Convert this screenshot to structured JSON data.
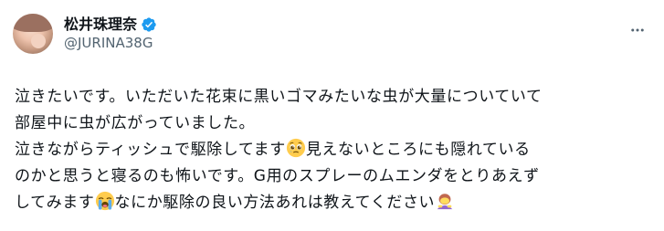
{
  "author": {
    "display_name": "松井珠理奈",
    "handle": "@JURINA38G",
    "avatar": "user-avatar-photo"
  },
  "icons": {
    "verified": "verified-badge-icon",
    "more": "more-options-icon"
  },
  "colors": {
    "verified": "#1d9bf0",
    "text": "#0f1419",
    "muted": "#536471"
  },
  "tweet": {
    "line1": "泣きたいです。いただいた花束に黒いゴマみたいな虫が大量についていて",
    "line2": "部屋中に虫が広がっていました。",
    "line3a": "泣きながらティッシュで駆除してます",
    "emoji_pleading": "🥹",
    "line3b": "見えないところにも隠れている",
    "line4": "のかと思うと寝るのも怖いです。G用のスプレーのムエンダをとりあえず",
    "line5a": "してみます",
    "emoji_crying": "😭",
    "line5b": "なにか駆除の良い方法あれは教えてください",
    "emoji_bowing": "🙇‍♀️"
  }
}
